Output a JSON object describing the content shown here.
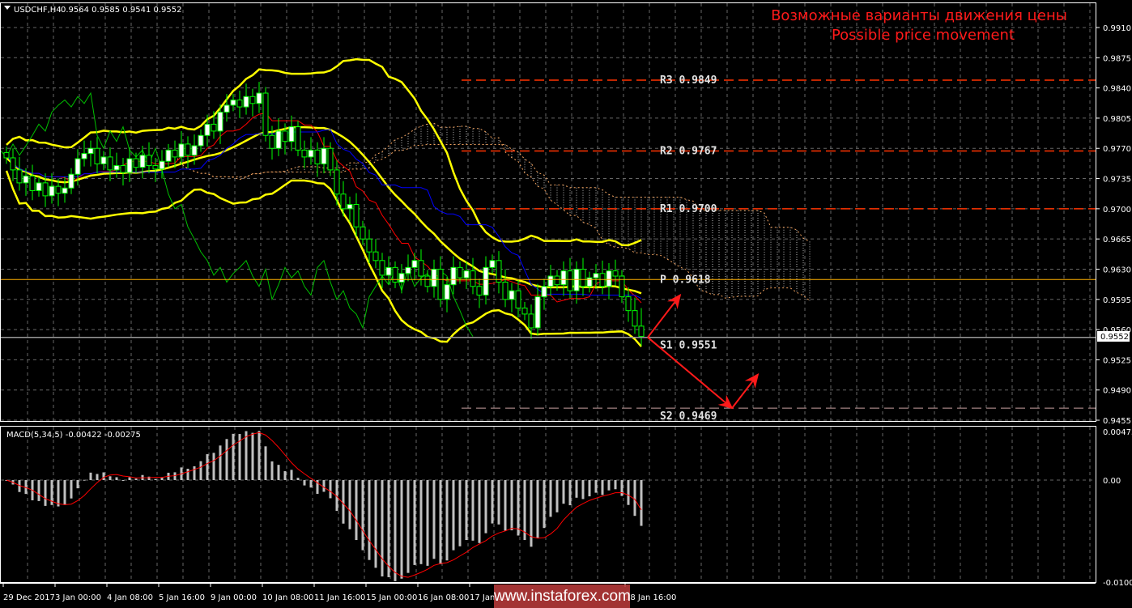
{
  "header": {
    "symbol_label": "USDCHF,H4",
    "ohlc_label": "0.9564 0.9585 0.9541 0.9552",
    "title_ru": "Возможные варианты движения цены",
    "title_en": "Possible price movement"
  },
  "macd_header": "MACD(5,34,5) -0.00422 -0.00275",
  "current_price": "0.9552",
  "watermark": "www.instaforex.com",
  "colors": {
    "bollinger": "#ffff00",
    "tenkan": "#ff0000",
    "kijun": "#0000ff",
    "chikou": "#00c000",
    "resistance": "#ff3300",
    "pivot": "#ffb000",
    "support": "#999999",
    "arrow": "#ff1a1a",
    "candle": "#00ff00"
  },
  "chart_data": [
    {
      "type": "candlestick",
      "title": "USDCHF H4",
      "timeframe": "H4",
      "ylim": [
        0.9455,
        0.991
      ],
      "y_ticks": [
        "0.9910",
        "0.9875",
        "0.9840",
        "0.9805",
        "0.9770",
        "0.9735",
        "0.9700",
        "0.9665",
        "0.9630",
        "0.9595",
        "0.9560",
        "0.9525",
        "0.9490",
        "0.9455"
      ],
      "x_ticks": [
        "29 Dec 2017",
        "3 Jan 00:00",
        "4 Jan 08:00",
        "5 Jan 16:00",
        "9 Jan 00:00",
        "10 Jan 08:00",
        "11 Jan 16:00",
        "15 Jan 00:00",
        "16 Jan 08:00",
        "17 Jan 16:00",
        "18 Jan 16:00"
      ],
      "last_bar": {
        "open": 0.9564,
        "high": 0.9585,
        "low": 0.9541,
        "close": 0.9552
      },
      "close": [
        0.9759,
        0.9745,
        0.973,
        0.9738,
        0.9721,
        0.973,
        0.9715,
        0.9726,
        0.9718,
        0.9724,
        0.974,
        0.9758,
        0.9764,
        0.977,
        0.9752,
        0.976,
        0.9745,
        0.975,
        0.9742,
        0.9758,
        0.9748,
        0.9762,
        0.975,
        0.9746,
        0.9755,
        0.9768,
        0.976,
        0.9775,
        0.9762,
        0.9773,
        0.9785,
        0.9798,
        0.979,
        0.9812,
        0.982,
        0.9826,
        0.9818,
        0.983,
        0.9822,
        0.9834,
        0.9785,
        0.977,
        0.979,
        0.9778,
        0.9795,
        0.9768,
        0.976,
        0.9768,
        0.9752,
        0.977,
        0.9745,
        0.9717,
        0.97,
        0.9705,
        0.9679,
        0.9665,
        0.965,
        0.964,
        0.9623,
        0.9632,
        0.9615,
        0.9625,
        0.9632,
        0.964,
        0.9622,
        0.961,
        0.963,
        0.9595,
        0.9612,
        0.9632,
        0.962,
        0.9628,
        0.961,
        0.96,
        0.9632,
        0.964,
        0.9615,
        0.9595,
        0.9605,
        0.9585,
        0.9578,
        0.9562,
        0.9598,
        0.961,
        0.9622,
        0.9612,
        0.9628,
        0.9605,
        0.963,
        0.961,
        0.962,
        0.9625,
        0.961,
        0.9628,
        0.9622,
        0.9598,
        0.9582,
        0.9564,
        0.9552
      ],
      "indicators": [
        "Bollinger Bands (20,2)",
        "Ichimoku Kinko Hyo (9,26,52)"
      ],
      "levels": [
        {
          "name": "R3",
          "value": "0.9849",
          "label": "R3 0.9849",
          "kind": "resistance"
        },
        {
          "name": "R2",
          "value": "0.9767",
          "label": "R2 0.9767",
          "kind": "resistance"
        },
        {
          "name": "R1",
          "value": "0.9700",
          "label": "R1 0.9700",
          "kind": "resistance"
        },
        {
          "name": "P",
          "value": "0.9618",
          "label": "P 0.9618",
          "kind": "pivot"
        },
        {
          "name": "S1",
          "value": "0.9551",
          "label": "S1 0.9551",
          "kind": "support"
        },
        {
          "name": "S2",
          "value": "0.9469",
          "label": "S2 0.9469",
          "kind": "support2"
        }
      ],
      "scenarios": [
        {
          "path": [
            0.9551,
            0.96
          ],
          "bars_ahead": [
            0,
            5
          ]
        },
        {
          "path": [
            0.9551,
            0.9469,
            0.9508
          ],
          "bars_ahead": [
            0,
            13,
            17
          ]
        }
      ]
    },
    {
      "type": "bar+line",
      "title": "MACD(5,34,5)",
      "macd_value": -0.00422,
      "signal_value": -0.00275,
      "ylim": [
        -0.01008,
        0.00473
      ],
      "y_ticks": [
        "0.00473",
        "0.00",
        "-0.01008"
      ]
    }
  ]
}
